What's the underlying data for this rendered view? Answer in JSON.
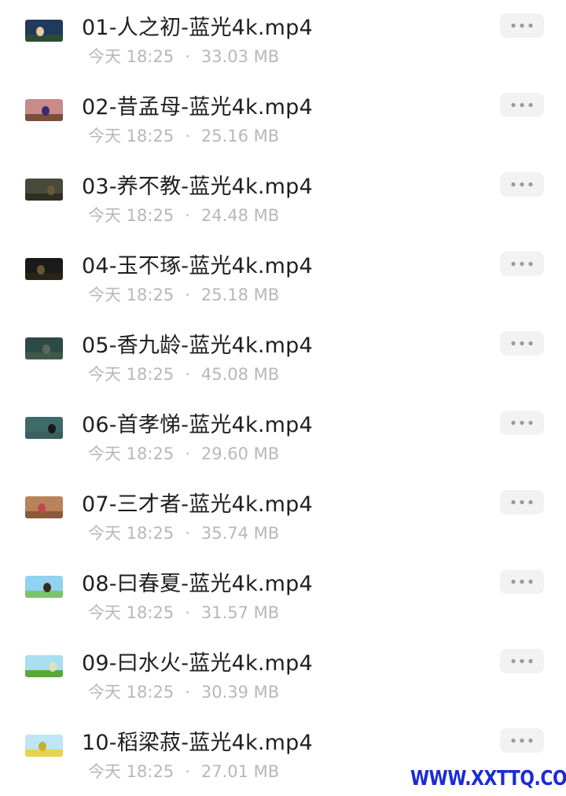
{
  "files": [
    {
      "name": "01-人之初-蓝光4k.mp4",
      "time": "今天 18:25",
      "size": "33.03 MB",
      "thumb": {
        "bg": "#1f3a5a",
        "band": "#2d4a35",
        "fig": "#e8c9a4"
      }
    },
    {
      "name": "02-昔孟母-蓝光4k.mp4",
      "time": "今天 18:25",
      "size": "25.16 MB",
      "thumb": {
        "bg": "#c98a8a",
        "band": "#7a4f3a",
        "fig": "#3a2a6a"
      }
    },
    {
      "name": "03-养不教-蓝光4k.mp4",
      "time": "今天 18:25",
      "size": "24.48 MB",
      "thumb": {
        "bg": "#4a4a3a",
        "band": "#2f2f24",
        "fig": "#6a5a3a"
      }
    },
    {
      "name": "04-玉不琢-蓝光4k.mp4",
      "time": "今天 18:25",
      "size": "25.18 MB",
      "thumb": {
        "bg": "#1a1a1a",
        "band": "#2a2418",
        "fig": "#6a5638"
      }
    },
    {
      "name": "05-香九龄-蓝光4k.mp4",
      "time": "今天 18:25",
      "size": "45.08 MB",
      "thumb": {
        "bg": "#2e4a48",
        "band": "#3d5a4a",
        "fig": "#5a6a5a"
      }
    },
    {
      "name": "06-首孝悌-蓝光4k.mp4",
      "time": "今天 18:25",
      "size": "29.60 MB",
      "thumb": {
        "bg": "#3f6a6a",
        "band": "#3a5e5e",
        "fig": "#1a1a1a"
      }
    },
    {
      "name": "07-三才者-蓝光4k.mp4",
      "time": "今天 18:25",
      "size": "35.74 MB",
      "thumb": {
        "bg": "#b9835a",
        "band": "#8a5a3a",
        "fig": "#c04a4a"
      }
    },
    {
      "name": "08-曰春夏-蓝光4k.mp4",
      "time": "今天 18:25",
      "size": "31.57 MB",
      "thumb": {
        "bg": "#8fd3f0",
        "band": "#7cc46a",
        "fig": "#3a2a1a"
      }
    },
    {
      "name": "09-曰水火-蓝光4k.mp4",
      "time": "今天 18:25",
      "size": "30.39 MB",
      "thumb": {
        "bg": "#a9dff0",
        "band": "#5aa83a",
        "fig": "#e0e0c0"
      }
    },
    {
      "name": "10-稻梁菽-蓝光4k.mp4",
      "time": "今天 18:25",
      "size": "27.01 MB",
      "thumb": {
        "bg": "#bfe6f5",
        "band": "#e8d24a",
        "fig": "#c8b030"
      }
    }
  ],
  "separator": "·",
  "more_icon": "more-horizontal-icon",
  "watermark": "WWW.XXTTQ.COM",
  "colors": {
    "title": "#1f1f1f",
    "meta": "#b8b8b8",
    "more_bg": "#f2f2f2",
    "more_dots": "#9a9a9a",
    "watermark": "#1a2bd6"
  }
}
